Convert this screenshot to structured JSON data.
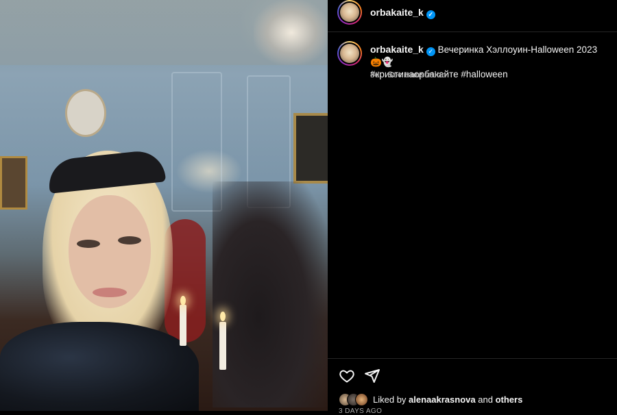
{
  "post": {
    "username": "orbakaite_k",
    "verified_icon": "verified-badge-icon",
    "caption_text": "Вечеринка Хэллоуин-Halloween 2023 🎃👻",
    "hashtags": "#кристинаорбакайте #halloween",
    "time_ago": "3d",
    "see_translation": "See translation",
    "liked_by_prefix": "Liked by",
    "liked_by_user": "alenaakrasnova",
    "liked_by_and": "and",
    "liked_by_others": "others",
    "date": "3 DAYS AGO"
  },
  "icons": {
    "like": "heart-icon",
    "share": "paper-plane-icon"
  },
  "colors": {
    "background": "#000000",
    "verified": "#0095f6",
    "muted": "#a8a8a8",
    "divider": "#262626"
  }
}
